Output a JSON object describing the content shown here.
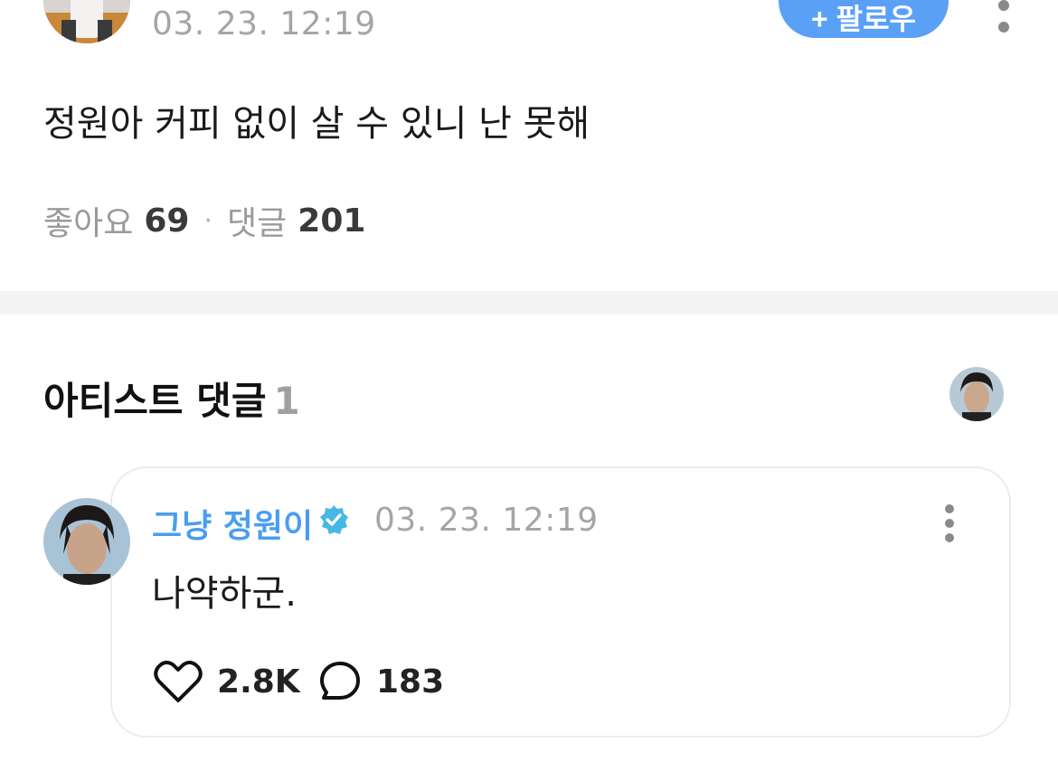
{
  "post": {
    "timestamp": "03. 23. 12:19",
    "follow_label": "+ 팔로우",
    "body": "정원아 커피 없이 살 수 있니 난 못해",
    "likes_label": "좋아요",
    "likes_count": "69",
    "separator": "·",
    "comments_label": "댓글",
    "comments_count": "201"
  },
  "artist_comments": {
    "title": "아티스트 댓글",
    "count": "1",
    "comment": {
      "author": "그냥 정원이",
      "timestamp": "03. 23. 12:19",
      "text": "나약하군.",
      "like_count": "2.8K",
      "reply_count": "183"
    }
  },
  "icons": {
    "more": "more-vertical-icon",
    "verified": "verified-badge-icon",
    "like": "heart-outline-icon",
    "reply": "speech-bubble-icon"
  },
  "colors": {
    "accent_blue": "#4a9df0",
    "follow_button": "#5aa0f7",
    "muted_text": "#a5a5a5",
    "verified_badge": "#45b8e6",
    "divider": "#f4f4f4"
  }
}
